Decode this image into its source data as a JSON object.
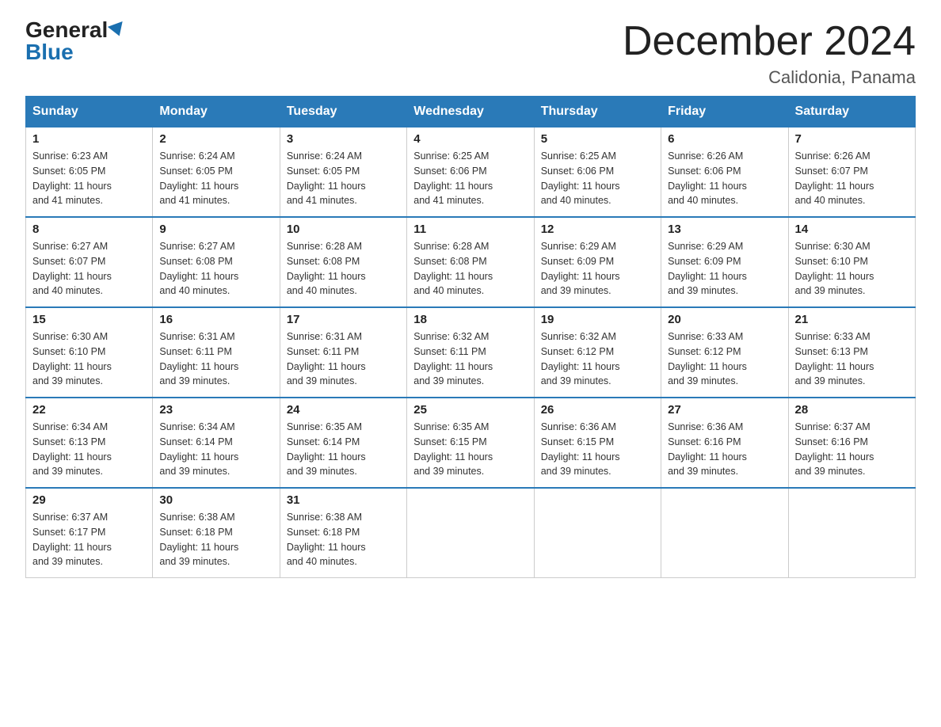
{
  "header": {
    "logo_general": "General",
    "logo_blue": "Blue",
    "month_title": "December 2024",
    "location": "Calidonia, Panama"
  },
  "days_of_week": [
    "Sunday",
    "Monday",
    "Tuesday",
    "Wednesday",
    "Thursday",
    "Friday",
    "Saturday"
  ],
  "weeks": [
    [
      {
        "day": "1",
        "sunrise": "6:23 AM",
        "sunset": "6:05 PM",
        "daylight": "11 hours and 41 minutes."
      },
      {
        "day": "2",
        "sunrise": "6:24 AM",
        "sunset": "6:05 PM",
        "daylight": "11 hours and 41 minutes."
      },
      {
        "day": "3",
        "sunrise": "6:24 AM",
        "sunset": "6:05 PM",
        "daylight": "11 hours and 41 minutes."
      },
      {
        "day": "4",
        "sunrise": "6:25 AM",
        "sunset": "6:06 PM",
        "daylight": "11 hours and 41 minutes."
      },
      {
        "day": "5",
        "sunrise": "6:25 AM",
        "sunset": "6:06 PM",
        "daylight": "11 hours and 40 minutes."
      },
      {
        "day": "6",
        "sunrise": "6:26 AM",
        "sunset": "6:06 PM",
        "daylight": "11 hours and 40 minutes."
      },
      {
        "day": "7",
        "sunrise": "6:26 AM",
        "sunset": "6:07 PM",
        "daylight": "11 hours and 40 minutes."
      }
    ],
    [
      {
        "day": "8",
        "sunrise": "6:27 AM",
        "sunset": "6:07 PM",
        "daylight": "11 hours and 40 minutes."
      },
      {
        "day": "9",
        "sunrise": "6:27 AM",
        "sunset": "6:08 PM",
        "daylight": "11 hours and 40 minutes."
      },
      {
        "day": "10",
        "sunrise": "6:28 AM",
        "sunset": "6:08 PM",
        "daylight": "11 hours and 40 minutes."
      },
      {
        "day": "11",
        "sunrise": "6:28 AM",
        "sunset": "6:08 PM",
        "daylight": "11 hours and 40 minutes."
      },
      {
        "day": "12",
        "sunrise": "6:29 AM",
        "sunset": "6:09 PM",
        "daylight": "11 hours and 39 minutes."
      },
      {
        "day": "13",
        "sunrise": "6:29 AM",
        "sunset": "6:09 PM",
        "daylight": "11 hours and 39 minutes."
      },
      {
        "day": "14",
        "sunrise": "6:30 AM",
        "sunset": "6:10 PM",
        "daylight": "11 hours and 39 minutes."
      }
    ],
    [
      {
        "day": "15",
        "sunrise": "6:30 AM",
        "sunset": "6:10 PM",
        "daylight": "11 hours and 39 minutes."
      },
      {
        "day": "16",
        "sunrise": "6:31 AM",
        "sunset": "6:11 PM",
        "daylight": "11 hours and 39 minutes."
      },
      {
        "day": "17",
        "sunrise": "6:31 AM",
        "sunset": "6:11 PM",
        "daylight": "11 hours and 39 minutes."
      },
      {
        "day": "18",
        "sunrise": "6:32 AM",
        "sunset": "6:11 PM",
        "daylight": "11 hours and 39 minutes."
      },
      {
        "day": "19",
        "sunrise": "6:32 AM",
        "sunset": "6:12 PM",
        "daylight": "11 hours and 39 minutes."
      },
      {
        "day": "20",
        "sunrise": "6:33 AM",
        "sunset": "6:12 PM",
        "daylight": "11 hours and 39 minutes."
      },
      {
        "day": "21",
        "sunrise": "6:33 AM",
        "sunset": "6:13 PM",
        "daylight": "11 hours and 39 minutes."
      }
    ],
    [
      {
        "day": "22",
        "sunrise": "6:34 AM",
        "sunset": "6:13 PM",
        "daylight": "11 hours and 39 minutes."
      },
      {
        "day": "23",
        "sunrise": "6:34 AM",
        "sunset": "6:14 PM",
        "daylight": "11 hours and 39 minutes."
      },
      {
        "day": "24",
        "sunrise": "6:35 AM",
        "sunset": "6:14 PM",
        "daylight": "11 hours and 39 minutes."
      },
      {
        "day": "25",
        "sunrise": "6:35 AM",
        "sunset": "6:15 PM",
        "daylight": "11 hours and 39 minutes."
      },
      {
        "day": "26",
        "sunrise": "6:36 AM",
        "sunset": "6:15 PM",
        "daylight": "11 hours and 39 minutes."
      },
      {
        "day": "27",
        "sunrise": "6:36 AM",
        "sunset": "6:16 PM",
        "daylight": "11 hours and 39 minutes."
      },
      {
        "day": "28",
        "sunrise": "6:37 AM",
        "sunset": "6:16 PM",
        "daylight": "11 hours and 39 minutes."
      }
    ],
    [
      {
        "day": "29",
        "sunrise": "6:37 AM",
        "sunset": "6:17 PM",
        "daylight": "11 hours and 39 minutes."
      },
      {
        "day": "30",
        "sunrise": "6:38 AM",
        "sunset": "6:18 PM",
        "daylight": "11 hours and 39 minutes."
      },
      {
        "day": "31",
        "sunrise": "6:38 AM",
        "sunset": "6:18 PM",
        "daylight": "11 hours and 40 minutes."
      },
      null,
      null,
      null,
      null
    ]
  ],
  "labels": {
    "sunrise": "Sunrise:",
    "sunset": "Sunset:",
    "daylight": "Daylight:"
  }
}
